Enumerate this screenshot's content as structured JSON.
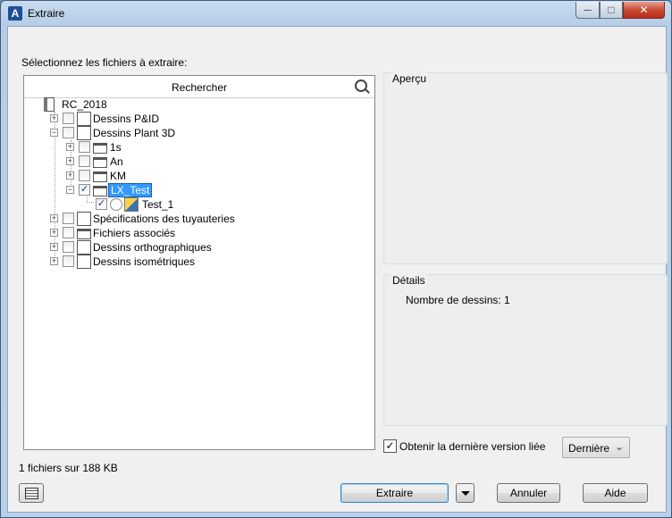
{
  "window": {
    "title": "Extraire",
    "app_icon_letter": "A"
  },
  "labels": {
    "select_files": "Sélectionnez les fichiers à extraire:"
  },
  "search": {
    "placeholder": "Rechercher",
    "icon": "search-icon"
  },
  "tree": {
    "root": "RC_2018",
    "items": [
      {
        "label": "Dessins P&ID",
        "checked": false,
        "expanded": false
      },
      {
        "label": "Dessins Plant 3D",
        "checked": false,
        "expanded": true
      },
      {
        "label": "1s",
        "checked": false,
        "expanded": false
      },
      {
        "label": "An",
        "checked": false,
        "expanded": false
      },
      {
        "label": "KM",
        "checked": false,
        "expanded": false
      },
      {
        "label": "LX_Test",
        "checked": true,
        "expanded": true,
        "selected": true
      },
      {
        "label": "Test_1",
        "checked": true
      },
      {
        "label": "Spécifications des tuyauteries",
        "checked": false,
        "expanded": false
      },
      {
        "label": "Fichiers associés",
        "checked": false,
        "expanded": false
      },
      {
        "label": "Dessins orthographiques",
        "checked": false,
        "expanded": false
      },
      {
        "label": "Dessins isométriques",
        "checked": false,
        "expanded": false
      }
    ]
  },
  "preview": {
    "title": "Aperçu"
  },
  "details": {
    "title": "Détails",
    "count_text": "Nombre de dessins: 1"
  },
  "latest": {
    "label": "Obtenir la dernière version liée",
    "checked": true,
    "option": "Dernière"
  },
  "status": {
    "text": "1 fichiers sur 188 KB"
  },
  "buttons": {
    "extract": "Extraire",
    "cancel": "Annuler",
    "help": "Aide"
  },
  "colors": {
    "selection": "#3399ff",
    "title_bar": "#b5cde6",
    "close_button": "#c7442e"
  }
}
